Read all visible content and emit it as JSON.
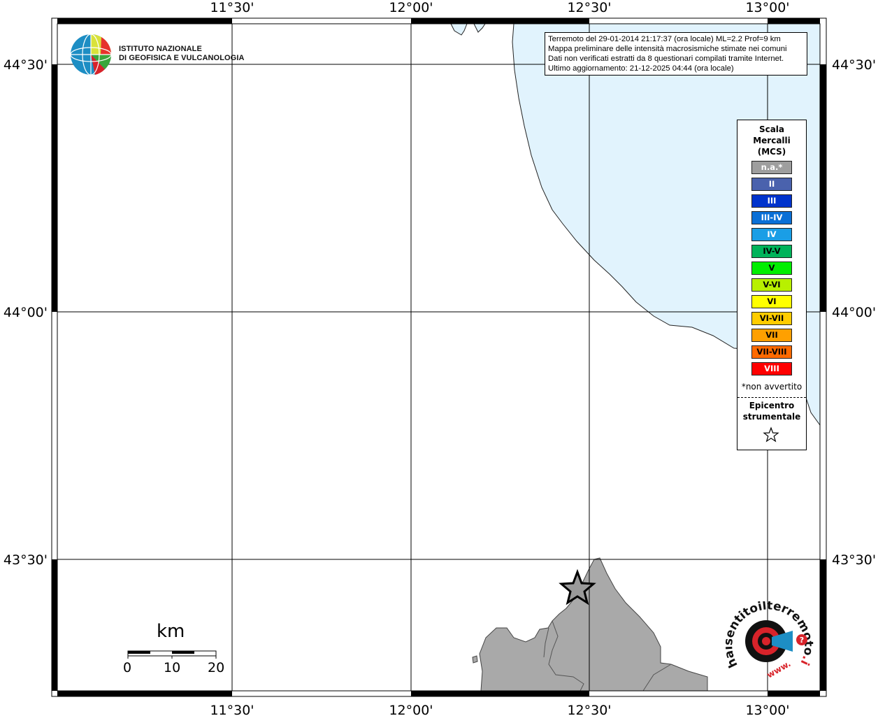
{
  "info": {
    "line1": "Terremoto del 29-01-2014 21:17:37 (ora locale) ML=2.2 Prof=9 km",
    "line2": "Mappa preliminare delle intensità macrosismiche stimate nei comuni",
    "line3": "Dati non verificati estratti da 8 questionari compilati tramite Internet.",
    "line4": "Ultimo aggiornamento: 21-12-2025 04:44 (ora locale)"
  },
  "logo": {
    "line1": "ISTITUTO NAZIONALE",
    "line2": "DI GEOFISICA E VULCANOLOGIA",
    "icon": "ingv-globe-icon"
  },
  "axes": {
    "lon_labels": [
      "11°30'",
      "12°00'",
      "12°30'",
      "13°00'"
    ],
    "lat_labels": [
      "44°30'",
      "44°00'",
      "43°30'"
    ]
  },
  "legend": {
    "title_line1": "Scala",
    "title_line2": "Mercalli",
    "title_line3": "(MCS)",
    "items": [
      {
        "label": "n.a.*",
        "color": "#9e9e9e"
      },
      {
        "label": "II",
        "color": "#4a62ad"
      },
      {
        "label": "III",
        "color": "#0033cc"
      },
      {
        "label": "III-IV",
        "color": "#0a6fd6"
      },
      {
        "label": "IV",
        "color": "#1a9ee6"
      },
      {
        "label": "IV-V",
        "color": "#00b35a"
      },
      {
        "label": "V",
        "color": "#00ee00"
      },
      {
        "label": "V-VI",
        "color": "#b8f000"
      },
      {
        "label": "VI",
        "color": "#ffff00"
      },
      {
        "label": "VI-VII",
        "color": "#ffcc00"
      },
      {
        "label": "VII",
        "color": "#ffa000"
      },
      {
        "label": "VII-VIII",
        "color": "#ff6a00"
      },
      {
        "label": "VIII",
        "color": "#ff0000"
      }
    ],
    "na_note": "*non avvertito",
    "epicenter_line1": "Epicentro",
    "epicenter_line2": "strumentale"
  },
  "scalebar": {
    "unit": "km",
    "ticks": [
      "0",
      "10",
      "20"
    ]
  },
  "epicenter": {
    "lon": "12°28'",
    "lat": "43°26'",
    "icon": "epicenter-star-icon"
  },
  "colors": {
    "sea": "#e1f3fd",
    "land_highlight": "#a9a9a9",
    "frame": "#000000"
  },
  "hsit_logo": {
    "text_main": "haisentitoilterremoto",
    "text_it": ".it",
    "text_www": "www.",
    "icon": "megaphone-target-icon"
  }
}
